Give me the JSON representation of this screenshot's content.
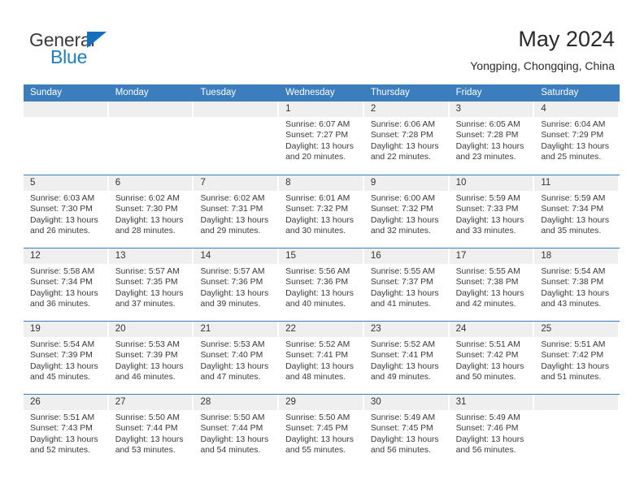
{
  "brand": {
    "name_top": "General",
    "name_bottom": "Blue",
    "accent_color": "#1a7ec8",
    "triangle_color": "#1170bf"
  },
  "header": {
    "title": "May 2024",
    "subtitle": "Yongping, Chongqing, China",
    "header_bg": "#3b7dbd",
    "datebar_bg": "#efefef"
  },
  "weekdays": [
    "Sunday",
    "Monday",
    "Tuesday",
    "Wednesday",
    "Thursday",
    "Friday",
    "Saturday"
  ],
  "weeks": [
    [
      {
        "day": "",
        "l1": "",
        "l2": "",
        "l3": "",
        "l4": ""
      },
      {
        "day": "",
        "l1": "",
        "l2": "",
        "l3": "",
        "l4": ""
      },
      {
        "day": "",
        "l1": "",
        "l2": "",
        "l3": "",
        "l4": ""
      },
      {
        "day": "1",
        "l1": "Sunrise: 6:07 AM",
        "l2": "Sunset: 7:27 PM",
        "l3": "Daylight: 13 hours",
        "l4": "and 20 minutes."
      },
      {
        "day": "2",
        "l1": "Sunrise: 6:06 AM",
        "l2": "Sunset: 7:28 PM",
        "l3": "Daylight: 13 hours",
        "l4": "and 22 minutes."
      },
      {
        "day": "3",
        "l1": "Sunrise: 6:05 AM",
        "l2": "Sunset: 7:28 PM",
        "l3": "Daylight: 13 hours",
        "l4": "and 23 minutes."
      },
      {
        "day": "4",
        "l1": "Sunrise: 6:04 AM",
        "l2": "Sunset: 7:29 PM",
        "l3": "Daylight: 13 hours",
        "l4": "and 25 minutes."
      }
    ],
    [
      {
        "day": "5",
        "l1": "Sunrise: 6:03 AM",
        "l2": "Sunset: 7:30 PM",
        "l3": "Daylight: 13 hours",
        "l4": "and 26 minutes."
      },
      {
        "day": "6",
        "l1": "Sunrise: 6:02 AM",
        "l2": "Sunset: 7:30 PM",
        "l3": "Daylight: 13 hours",
        "l4": "and 28 minutes."
      },
      {
        "day": "7",
        "l1": "Sunrise: 6:02 AM",
        "l2": "Sunset: 7:31 PM",
        "l3": "Daylight: 13 hours",
        "l4": "and 29 minutes."
      },
      {
        "day": "8",
        "l1": "Sunrise: 6:01 AM",
        "l2": "Sunset: 7:32 PM",
        "l3": "Daylight: 13 hours",
        "l4": "and 30 minutes."
      },
      {
        "day": "9",
        "l1": "Sunrise: 6:00 AM",
        "l2": "Sunset: 7:32 PM",
        "l3": "Daylight: 13 hours",
        "l4": "and 32 minutes."
      },
      {
        "day": "10",
        "l1": "Sunrise: 5:59 AM",
        "l2": "Sunset: 7:33 PM",
        "l3": "Daylight: 13 hours",
        "l4": "and 33 minutes."
      },
      {
        "day": "11",
        "l1": "Sunrise: 5:59 AM",
        "l2": "Sunset: 7:34 PM",
        "l3": "Daylight: 13 hours",
        "l4": "and 35 minutes."
      }
    ],
    [
      {
        "day": "12",
        "l1": "Sunrise: 5:58 AM",
        "l2": "Sunset: 7:34 PM",
        "l3": "Daylight: 13 hours",
        "l4": "and 36 minutes."
      },
      {
        "day": "13",
        "l1": "Sunrise: 5:57 AM",
        "l2": "Sunset: 7:35 PM",
        "l3": "Daylight: 13 hours",
        "l4": "and 37 minutes."
      },
      {
        "day": "14",
        "l1": "Sunrise: 5:57 AM",
        "l2": "Sunset: 7:36 PM",
        "l3": "Daylight: 13 hours",
        "l4": "and 39 minutes."
      },
      {
        "day": "15",
        "l1": "Sunrise: 5:56 AM",
        "l2": "Sunset: 7:36 PM",
        "l3": "Daylight: 13 hours",
        "l4": "and 40 minutes."
      },
      {
        "day": "16",
        "l1": "Sunrise: 5:55 AM",
        "l2": "Sunset: 7:37 PM",
        "l3": "Daylight: 13 hours",
        "l4": "and 41 minutes."
      },
      {
        "day": "17",
        "l1": "Sunrise: 5:55 AM",
        "l2": "Sunset: 7:38 PM",
        "l3": "Daylight: 13 hours",
        "l4": "and 42 minutes."
      },
      {
        "day": "18",
        "l1": "Sunrise: 5:54 AM",
        "l2": "Sunset: 7:38 PM",
        "l3": "Daylight: 13 hours",
        "l4": "and 43 minutes."
      }
    ],
    [
      {
        "day": "19",
        "l1": "Sunrise: 5:54 AM",
        "l2": "Sunset: 7:39 PM",
        "l3": "Daylight: 13 hours",
        "l4": "and 45 minutes."
      },
      {
        "day": "20",
        "l1": "Sunrise: 5:53 AM",
        "l2": "Sunset: 7:39 PM",
        "l3": "Daylight: 13 hours",
        "l4": "and 46 minutes."
      },
      {
        "day": "21",
        "l1": "Sunrise: 5:53 AM",
        "l2": "Sunset: 7:40 PM",
        "l3": "Daylight: 13 hours",
        "l4": "and 47 minutes."
      },
      {
        "day": "22",
        "l1": "Sunrise: 5:52 AM",
        "l2": "Sunset: 7:41 PM",
        "l3": "Daylight: 13 hours",
        "l4": "and 48 minutes."
      },
      {
        "day": "23",
        "l1": "Sunrise: 5:52 AM",
        "l2": "Sunset: 7:41 PM",
        "l3": "Daylight: 13 hours",
        "l4": "and 49 minutes."
      },
      {
        "day": "24",
        "l1": "Sunrise: 5:51 AM",
        "l2": "Sunset: 7:42 PM",
        "l3": "Daylight: 13 hours",
        "l4": "and 50 minutes."
      },
      {
        "day": "25",
        "l1": "Sunrise: 5:51 AM",
        "l2": "Sunset: 7:42 PM",
        "l3": "Daylight: 13 hours",
        "l4": "and 51 minutes."
      }
    ],
    [
      {
        "day": "26",
        "l1": "Sunrise: 5:51 AM",
        "l2": "Sunset: 7:43 PM",
        "l3": "Daylight: 13 hours",
        "l4": "and 52 minutes."
      },
      {
        "day": "27",
        "l1": "Sunrise: 5:50 AM",
        "l2": "Sunset: 7:44 PM",
        "l3": "Daylight: 13 hours",
        "l4": "and 53 minutes."
      },
      {
        "day": "28",
        "l1": "Sunrise: 5:50 AM",
        "l2": "Sunset: 7:44 PM",
        "l3": "Daylight: 13 hours",
        "l4": "and 54 minutes."
      },
      {
        "day": "29",
        "l1": "Sunrise: 5:50 AM",
        "l2": "Sunset: 7:45 PM",
        "l3": "Daylight: 13 hours",
        "l4": "and 55 minutes."
      },
      {
        "day": "30",
        "l1": "Sunrise: 5:49 AM",
        "l2": "Sunset: 7:45 PM",
        "l3": "Daylight: 13 hours",
        "l4": "and 56 minutes."
      },
      {
        "day": "31",
        "l1": "Sunrise: 5:49 AM",
        "l2": "Sunset: 7:46 PM",
        "l3": "Daylight: 13 hours",
        "l4": "and 56 minutes."
      },
      {
        "day": "",
        "l1": "",
        "l2": "",
        "l3": "",
        "l4": ""
      }
    ]
  ]
}
